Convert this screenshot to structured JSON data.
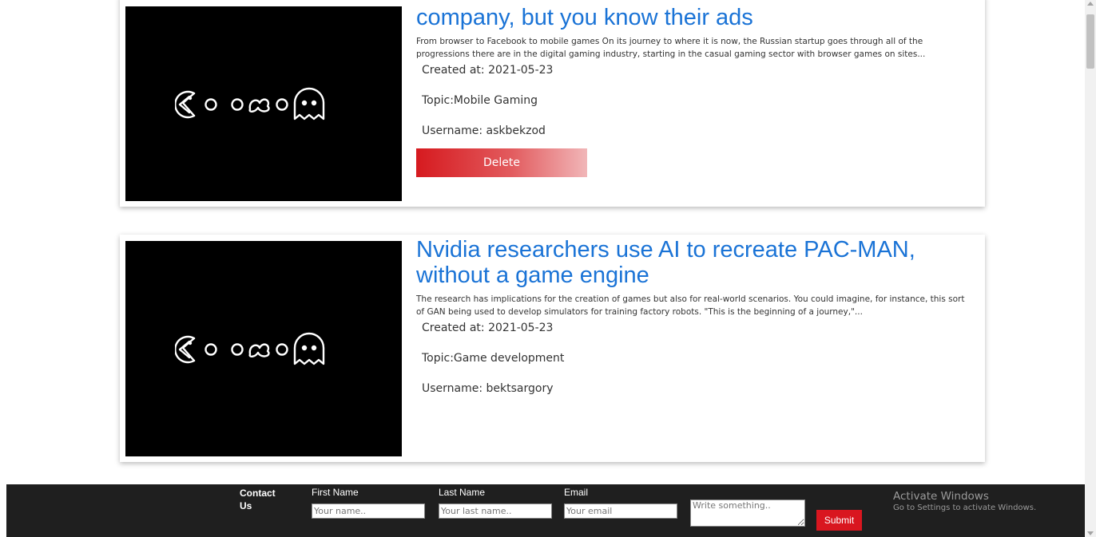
{
  "articles": [
    {
      "title": "company, but you know their ads",
      "excerpt": "From browser to Facebook to mobile games On its journey to where it is now, the Russian startup goes through all of the progressions there are in the digital gaming industry, starting in the casual gaming sector with browser games on sites...",
      "created": "Created at: 2021-05-23",
      "topic": "Topic:Mobile Gaming",
      "username": "Username: askbekzod",
      "delete_label": "Delete"
    },
    {
      "title": "Nvidia researchers use AI to recreate PAC-MAN, without a game engine",
      "excerpt": "The research has implications for the creation of games but also for real-world scenarios. You could imagine, for instance, this sort of GAN being used to develop simulators for training factory robots. \"This is the beginning of a journey,\"...",
      "created": "Created at: 2021-05-23",
      "topic": "Topic:Game development",
      "username": "Username: bektsargory"
    }
  ],
  "footer": {
    "contact_title": "Contact Us",
    "first_name_label": "First Name",
    "first_name_placeholder": "Your name..",
    "last_name_label": "Last Name",
    "last_name_placeholder": "Your last name..",
    "email_label": "Email",
    "email_placeholder": "Your email",
    "message_placeholder": "Write something..",
    "submit_label": "Submit"
  },
  "watermark": {
    "title": "Activate Windows",
    "subtitle": "Go to Settings to activate Windows."
  },
  "colors": {
    "title_blue": "#1a73d6",
    "delete_red": "#d61a1f",
    "footer_bg": "#1f1f1f",
    "submit_red": "#d9161f"
  },
  "icons": [
    "pacman-logo-icon"
  ]
}
